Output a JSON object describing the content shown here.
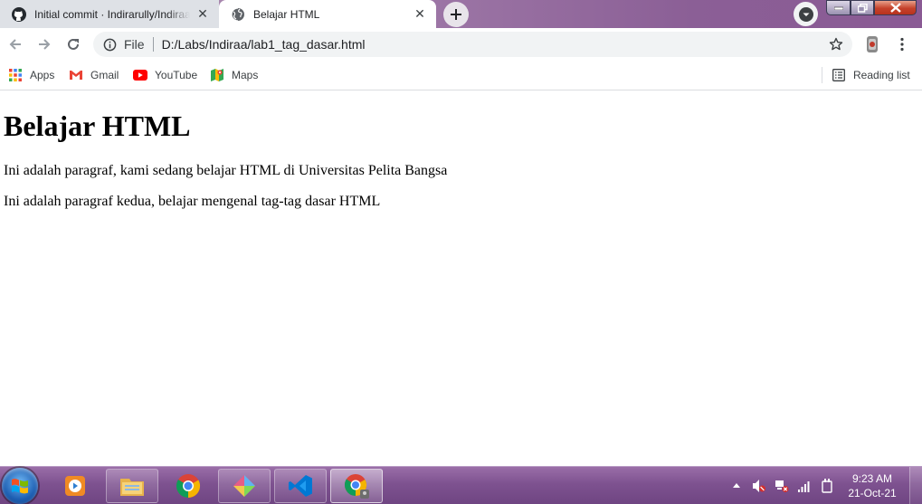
{
  "browser": {
    "tabs": [
      {
        "title": "Initial commit · Indirarully/Indiraa",
        "favicon": "github-icon",
        "active": false
      },
      {
        "title": "Belajar HTML",
        "favicon": "globe-icon",
        "active": true
      }
    ],
    "address": {
      "scheme_label": "File",
      "url": "D:/Labs/Indiraa/lab1_tag_dasar.html"
    },
    "bookmarks": [
      {
        "label": "Apps",
        "icon": "apps-grid-icon"
      },
      {
        "label": "Gmail",
        "icon": "gmail-icon"
      },
      {
        "label": "YouTube",
        "icon": "youtube-icon"
      },
      {
        "label": "Maps",
        "icon": "maps-icon"
      }
    ],
    "reading_list_label": "Reading list"
  },
  "page": {
    "heading": "Belajar HTML",
    "paragraphs": [
      "Ini adalah paragraf, kami sedang belajar HTML di Universitas Pelita Bangsa",
      "Ini adalah paragraf kedua, belajar mengenal tag-tag dasar HTML"
    ]
  },
  "taskbar": {
    "apps": [
      "media-player-icon",
      "file-explorer-icon",
      "chrome-icon",
      "gitkraken-icon",
      "vscode-icon",
      "chrome-active-icon"
    ],
    "clock": {
      "time": "9:23 AM",
      "date": "21-Oct-21"
    }
  },
  "colors": {
    "titlebar": "#a07ba9",
    "taskbar": "#7e5290",
    "accent": "#1a73e8"
  }
}
